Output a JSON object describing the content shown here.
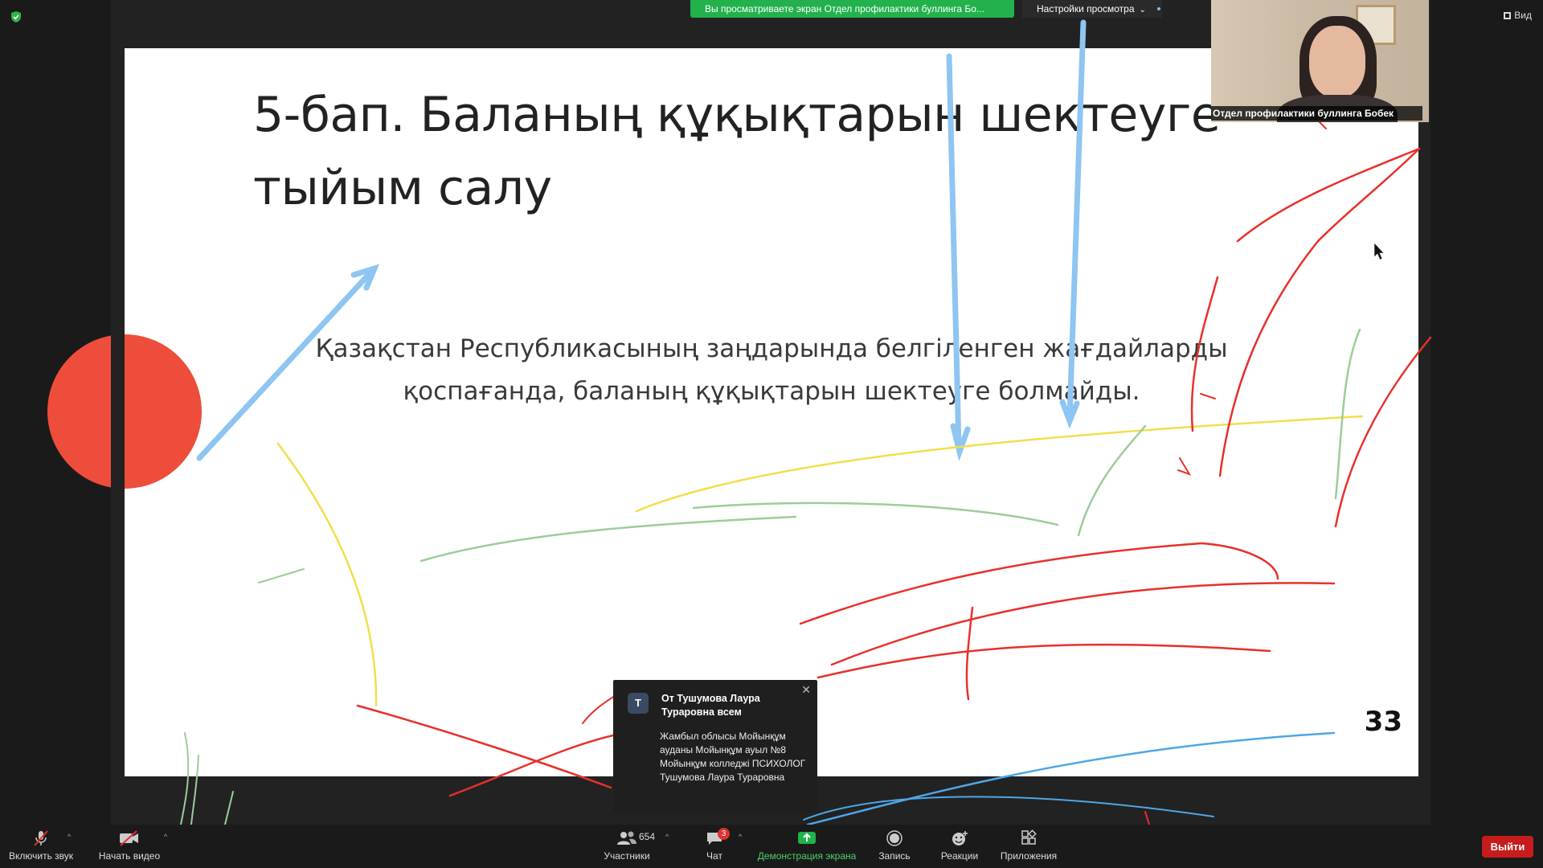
{
  "top_bar": {
    "share_banner": "Вы просматриваете экран Отдел профилактики буллинга Бо...",
    "view_settings": "Настройки просмотра",
    "view_toggle": "Вид"
  },
  "video_tile": {
    "name": "Отдел профилактики буллинга Бобек"
  },
  "slide": {
    "title_line1": "5-бап. Баланың құқықтарын шектеуге",
    "title_line2": "тыйым салу",
    "body_line1": "Қазақстан Республикасының заңдарында белгіленген жағдайларды",
    "body_line2": "қоспағанда, баланың құқықтарын шектеуге болмайды.",
    "page_number": "33"
  },
  "chat_popup": {
    "avatar_initial": "T",
    "from": "От Тушумова Лаура Тураровна всем",
    "message": "Жамбыл облысы Мойынқұм ауданы Мойынқұм ауыл №8 Мойынқұм колледжі ПСИХОЛОГ Тушумова Лаура Тураровна"
  },
  "toolbar": {
    "audio_label": "Включить звук",
    "video_label": "Начать видео",
    "participants_label": "Участники",
    "participants_count": "654",
    "chat_label": "Чат",
    "chat_badge": "3",
    "share_label": "Демонстрация экрана",
    "record_label": "Запись",
    "reactions_label": "Реакции",
    "apps_label": "Приложения",
    "leave_label": "Выйти"
  },
  "colors": {
    "share_green": "#22b14c",
    "leave_red": "#c71c1c",
    "annotation_red": "#e8302a",
    "annotation_blue": "#8ec5f2",
    "annotation_yellow": "#f2de4a",
    "annotation_green": "#9dcc9a"
  }
}
